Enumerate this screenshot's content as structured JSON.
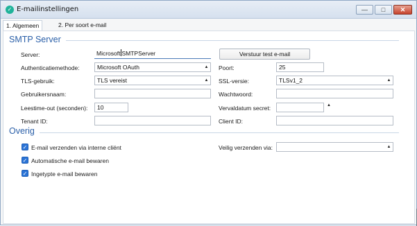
{
  "window": {
    "title": "E-mailinstellingen",
    "icon": "app-icon",
    "controls": {
      "minimize": "—",
      "maximize": "□",
      "close": "✕"
    }
  },
  "tabs": [
    {
      "label": "1. Algemeen",
      "active": true
    },
    {
      "label": "2. Per soort e-mail",
      "active": false
    }
  ],
  "smtp": {
    "title": "SMTP Server",
    "server_label": "Server:",
    "server_value": "MicrosoftSMTPServer",
    "server_value_before_cursor": "Microsoft",
    "server_value_after_cursor": "SMTPServer",
    "test_button": "Verstuur test e-mail",
    "auth_label": "Authenticatiemethode:",
    "auth_value": "Microsoft OAuth",
    "port_label": "Poort:",
    "port_value": "25",
    "tls_label": "TLS-gebruik:",
    "tls_value": "TLS vereist",
    "ssl_label": "SSL-versie:",
    "ssl_value": "TLSv1_2",
    "user_label": "Gebruikersnaam:",
    "user_value": "",
    "password_label": "Wachtwoord:",
    "password_value": "",
    "timeout_label": "Leestime-out (seconden):",
    "timeout_value": "10",
    "expiry_label": "Vervaldatum secret:",
    "expiry_value": "",
    "tenant_label": "Tenant ID:",
    "tenant_value": "",
    "client_label": "Client ID:",
    "client_value": ""
  },
  "overig": {
    "title": "Overig",
    "checkboxes": [
      {
        "label": "E-mail verzenden via interne cliënt",
        "checked": true
      },
      {
        "label": "Automatische e-mail bewaren",
        "checked": true
      },
      {
        "label": "Ingetypte e-mail bewaren",
        "checked": true
      }
    ],
    "secure_label": "Veilig verzenden via:",
    "secure_value": ""
  },
  "colors": {
    "accent": "#2a5fa8",
    "checkbox": "#2b74d6",
    "close_button": "#c7432c"
  }
}
